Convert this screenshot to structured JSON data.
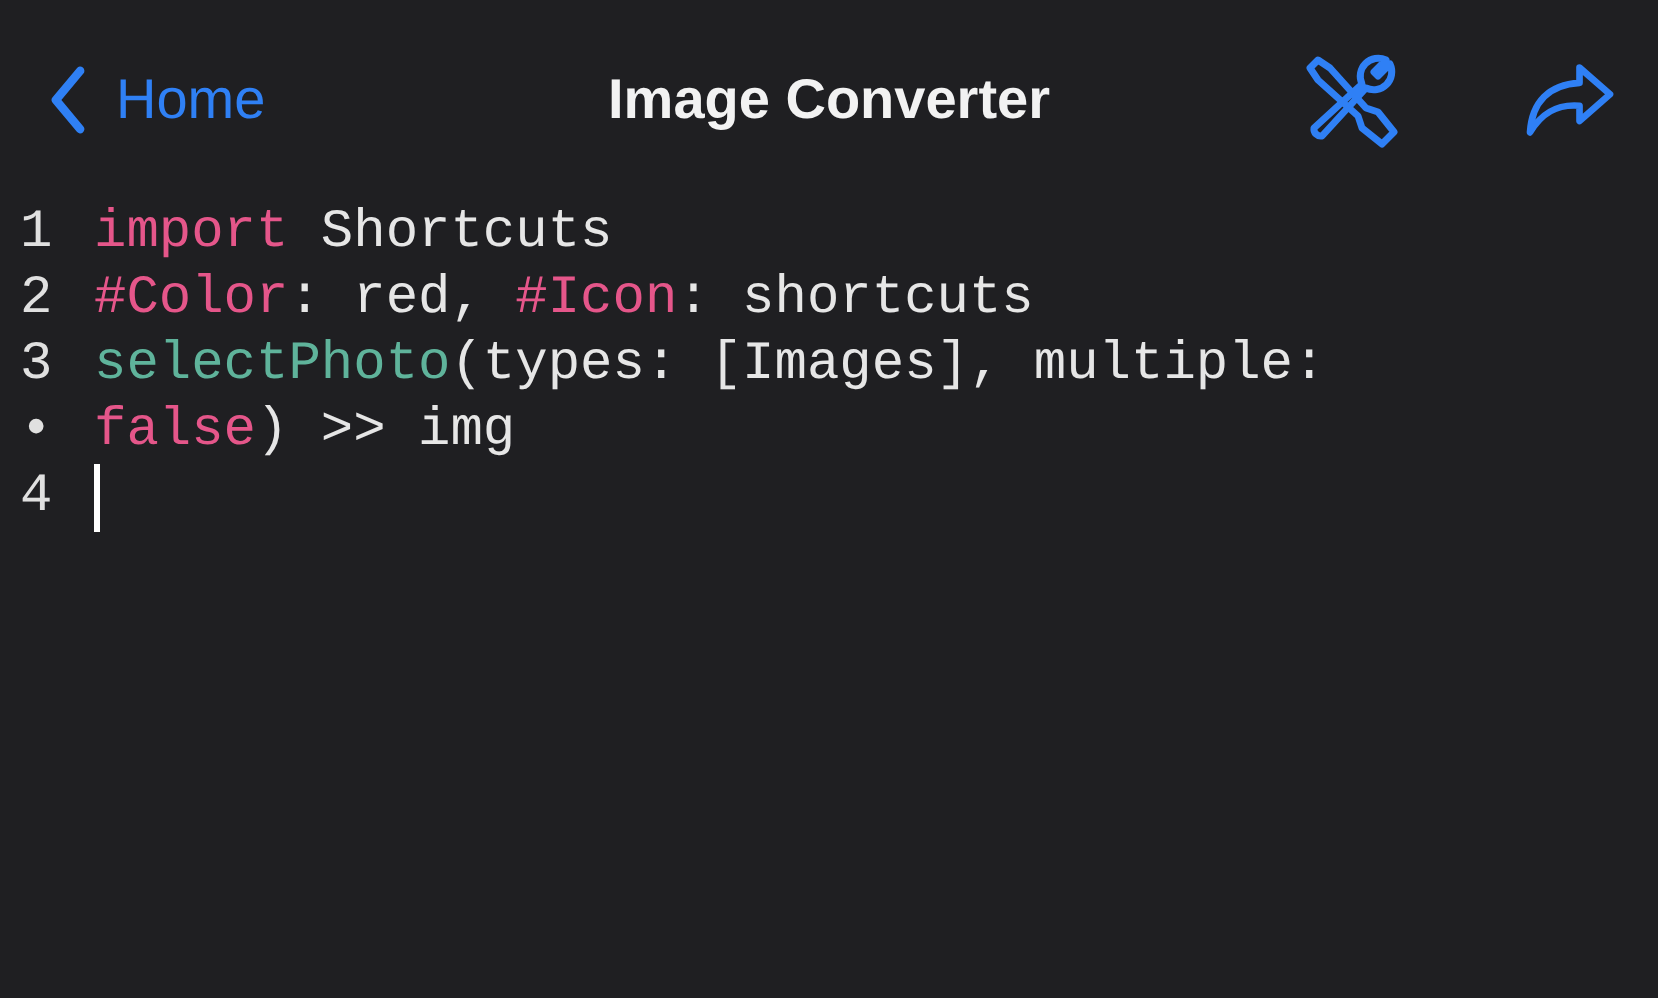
{
  "nav": {
    "back_label": "Home",
    "title": "Image Converter"
  },
  "editor": {
    "rows": [
      {
        "gutter": "1",
        "cursor": false,
        "tokens": [
          {
            "text": "import",
            "kind": "keyword"
          },
          {
            "text": " Shortcuts",
            "kind": "plain"
          }
        ]
      },
      {
        "gutter": "2",
        "cursor": false,
        "tokens": [
          {
            "text": "#Color",
            "kind": "keyword"
          },
          {
            "text": ": red, ",
            "kind": "plain"
          },
          {
            "text": "#Icon",
            "kind": "keyword"
          },
          {
            "text": ": shortcuts",
            "kind": "plain"
          }
        ]
      },
      {
        "gutter": "3",
        "cursor": false,
        "tokens": [
          {
            "text": "selectPhoto",
            "kind": "function"
          },
          {
            "text": "(types: [Images], multiple:",
            "kind": "plain"
          }
        ]
      },
      {
        "gutter": "•",
        "cursor": false,
        "tokens": [
          {
            "text": "false",
            "kind": "keyword"
          },
          {
            "text": ") >> img",
            "kind": "plain"
          }
        ]
      },
      {
        "gutter": "4",
        "cursor": true,
        "tokens": []
      }
    ]
  }
}
